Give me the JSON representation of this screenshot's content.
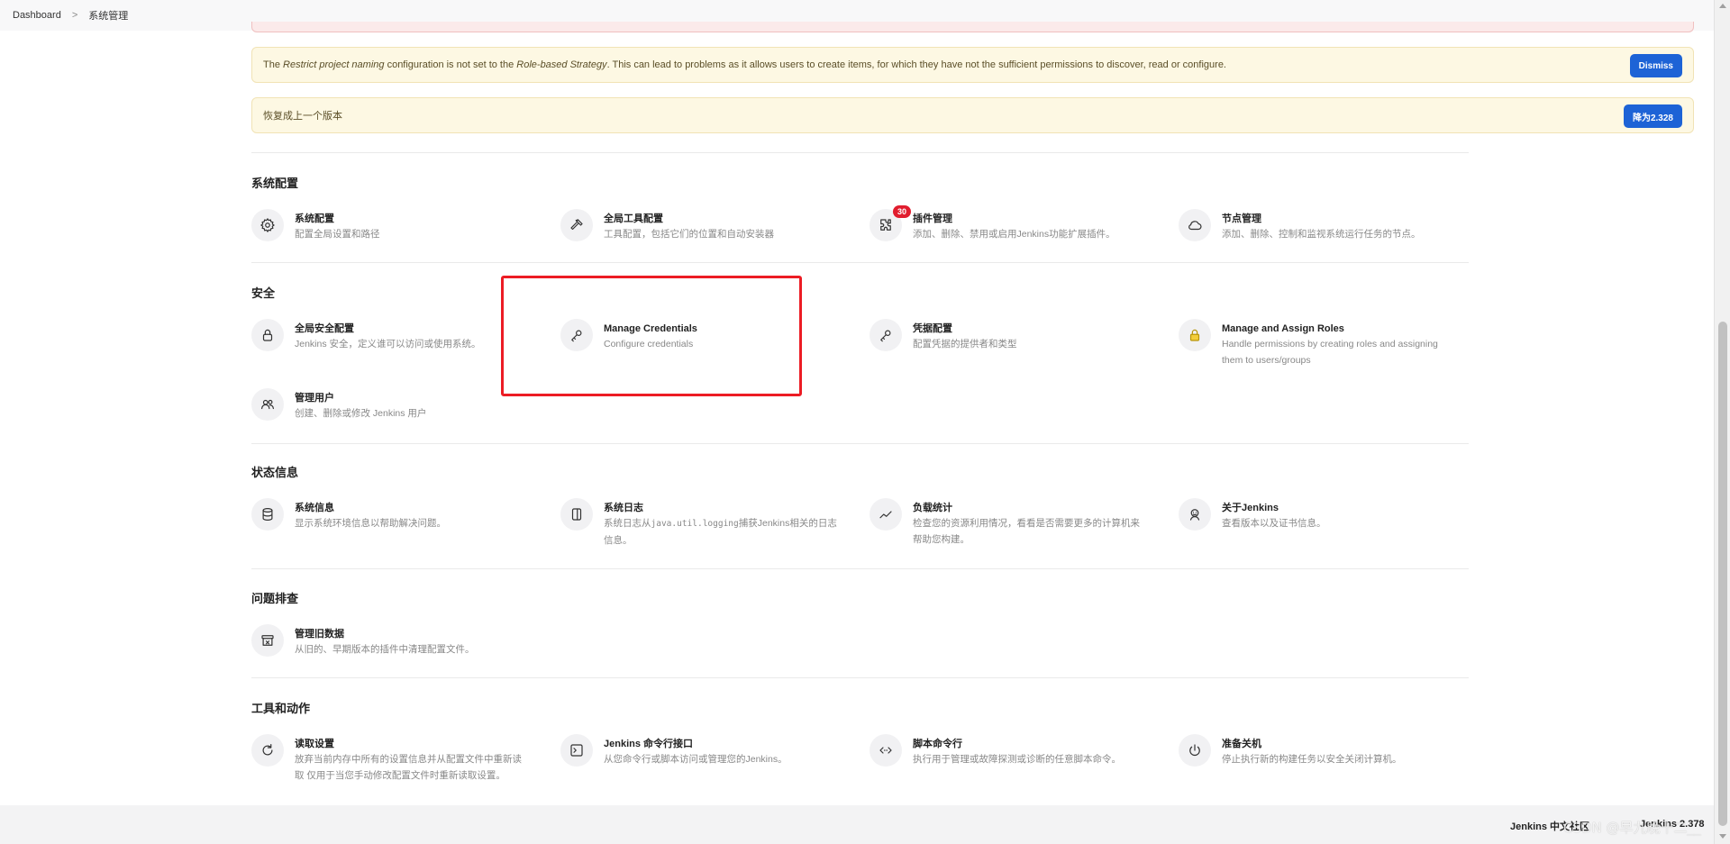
{
  "breadcrumb": {
    "items": [
      "Dashboard",
      "系统管理"
    ],
    "separator": ">"
  },
  "alerts": {
    "naming": {
      "prefix": "The ",
      "em1": "Restrict project naming",
      "mid": " configuration is not set to the ",
      "em2": "Role-based Strategy",
      "suffix": ". This can lead to problems as it allows users to create items, for which they have not the sufficient permissions to discover, read or configure.",
      "button": "Dismiss"
    },
    "downgrade": {
      "text": "恢复成上一个版本",
      "button": "降为2.328"
    }
  },
  "sections": {
    "config": {
      "title": "系统配置",
      "items": [
        {
          "title": "系统配置",
          "desc": "配置全局设置和路径",
          "icon": "gear-icon"
        },
        {
          "title": "全局工具配置",
          "desc": "工具配置，包括它们的位置和自动安装器",
          "icon": "hammer-icon"
        },
        {
          "title": "插件管理",
          "desc": "添加、删除、禁用或启用Jenkins功能扩展插件。",
          "icon": "puzzle-icon",
          "badge": "30"
        },
        {
          "title": "节点管理",
          "desc": "添加、删除、控制和监视系统运行任务的节点。",
          "icon": "cloud-icon"
        }
      ]
    },
    "security": {
      "title": "安全",
      "items": [
        {
          "title": "全局安全配置",
          "desc": "Jenkins 安全，定义谁可以访问或使用系统。",
          "icon": "lock-icon"
        },
        {
          "title": "Manage Credentials",
          "desc": "Configure credentials",
          "icon": "key-icon"
        },
        {
          "title": "凭据配置",
          "desc": "配置凭据的提供者和类型",
          "icon": "key-icon"
        },
        {
          "title": "Manage and Assign Roles",
          "desc1": "Handle permissions by creating roles and assigning",
          "desc2": "them to users/groups",
          "icon": "padlock-icon"
        },
        {
          "title": "管理用户",
          "desc": "创建、删除或修改 Jenkins 用户",
          "icon": "users-icon"
        }
      ]
    },
    "status": {
      "title": "状态信息",
      "items": [
        {
          "title": "系统信息",
          "desc": "显示系统环境信息以帮助解决问题。",
          "icon": "database-icon"
        },
        {
          "title": "系统日志",
          "desc1a": "系统日志从",
          "desc1code": "java.util.logging",
          "desc1b": "捕获Jenkins相关的日志",
          "desc2": "信息。",
          "icon": "log-icon"
        },
        {
          "title": "负载统计",
          "desc1": "检查您的资源利用情况，看看是否需要更多的计算机来",
          "desc2": "帮助您构建。",
          "icon": "chart-icon"
        },
        {
          "title": "关于Jenkins",
          "desc": "查看版本以及证书信息。",
          "icon": "jenkins-icon"
        }
      ]
    },
    "trouble": {
      "title": "问题排查",
      "items": [
        {
          "title": "管理旧数据",
          "desc": "从旧的、早期版本的插件中清理配置文件。",
          "icon": "archive-icon"
        }
      ]
    },
    "tools": {
      "title": "工具和动作",
      "items": [
        {
          "title": "读取设置",
          "desc1": "放弃当前内存中所有的设置信息并从配置文件中重新读",
          "desc2": "取 仅用于当您手动修改配置文件时重新读取设置。",
          "icon": "reload-icon"
        },
        {
          "title": "Jenkins 命令行接口",
          "desc": "从您命令行或脚本访问或管理您的Jenkins。",
          "icon": "terminal-icon"
        },
        {
          "title": "脚本命令行",
          "desc": "执行用于管理或故障探测或诊断的任意脚本命令。",
          "icon": "code-icon"
        },
        {
          "title": "准备关机",
          "desc": "停止执行新的构建任务以安全关闭计算机。",
          "icon": "power-icon"
        }
      ]
    }
  },
  "footer": {
    "community": "Jenkins 中文社区",
    "version": "Jenkins 2.378"
  },
  "watermark": "CSDN @早九晚十二__"
}
